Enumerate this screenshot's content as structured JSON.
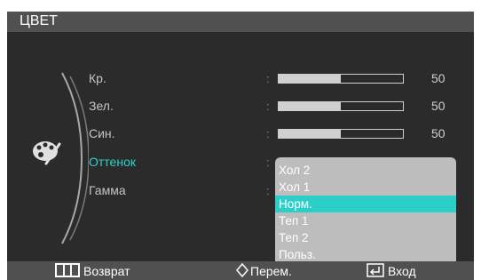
{
  "title": "ЦВЕТ",
  "menu_items": [
    {
      "label": "Кр.",
      "value": "50",
      "level": 0.5
    },
    {
      "label": "Зел.",
      "value": "50",
      "level": 0.5
    },
    {
      "label": "Син.",
      "value": "50",
      "level": 0.5
    },
    {
      "label": "Оттенок"
    },
    {
      "label": "Гамма"
    }
  ],
  "separator": ":",
  "dropdown": {
    "options": [
      "Хол 2",
      "Хол 1",
      "Норм.",
      "Теп 1",
      "Теп 2",
      "Польз."
    ],
    "selected": "Норм."
  },
  "footer": {
    "back_label": "Возврат",
    "move_label": "Перем.",
    "enter_label": "Вход"
  },
  "colors": {
    "accent": "#2ed3c8",
    "highlight": "#2ccfc8",
    "background": "#2b2b2b",
    "bar": "#505050"
  },
  "icons": {
    "menu": "palette-icon",
    "back": "return-grid-icon",
    "move": "up-down-arrow-icon",
    "enter": "enter-icon"
  }
}
